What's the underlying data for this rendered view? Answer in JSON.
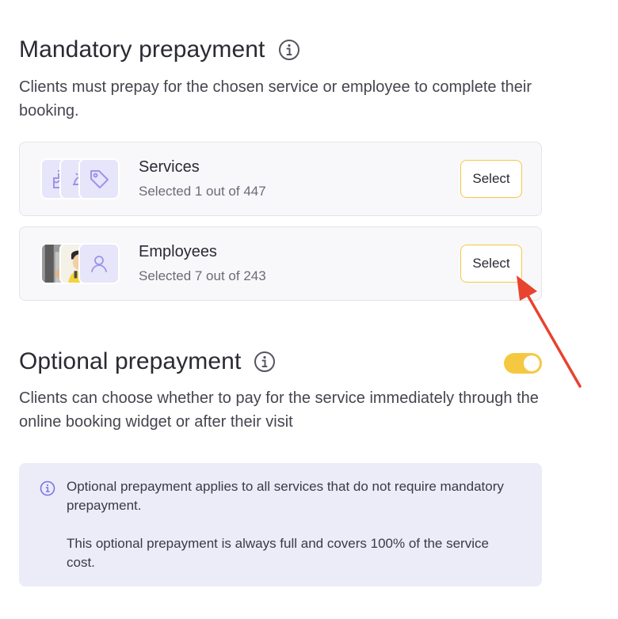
{
  "mandatory": {
    "title": "Mandatory prepayment",
    "description": "Clients must prepay for the chosen service or employee to complete their booking.",
    "services": {
      "label": "Services",
      "status": "Selected 1 out of 447",
      "select_label": "Select"
    },
    "employees": {
      "label": "Employees",
      "status": "Selected 7 out of 243",
      "select_label": "Select"
    }
  },
  "optional": {
    "title": "Optional prepayment",
    "description": "Clients can choose whether to pay for the service immediately through the online booking widget or after their visit",
    "toggle_on": true,
    "notice_line1": "Optional prepayment applies to all services that do not require mandatory prepayment.",
    "notice_line2": "This optional prepayment is always full and covers 100% of the service cost."
  },
  "icons": [
    "info-icon",
    "cake-icon",
    "service-icon",
    "tag-icon",
    "user-icon",
    "arrow-annotation"
  ],
  "colors": {
    "accent": "#f5c842",
    "notice_bg": "#ececf9",
    "icon_purple": "#9b95e8",
    "arrow": "#e8432e"
  }
}
